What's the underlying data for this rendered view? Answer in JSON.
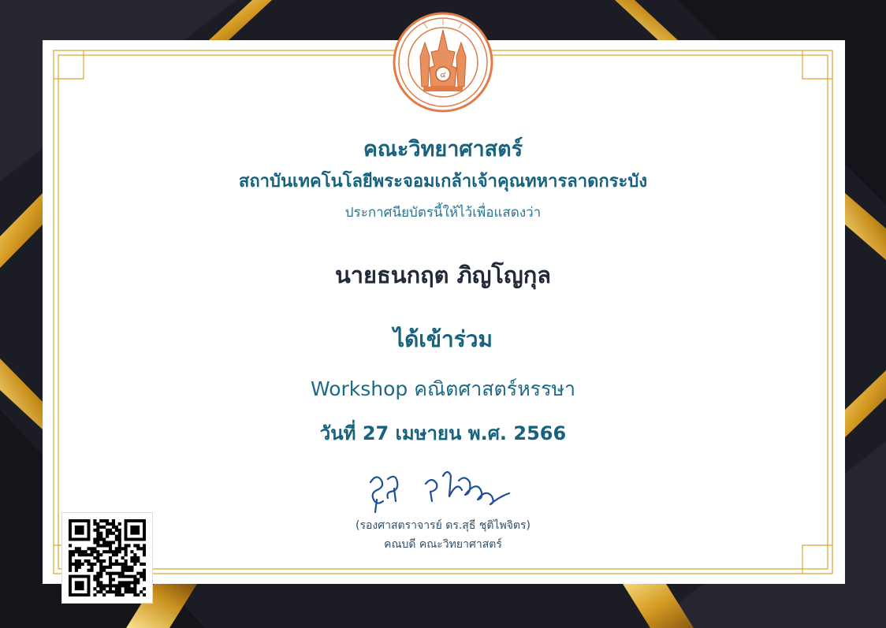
{
  "certificate": {
    "faculty": "คณะวิทยาศาสตร์",
    "institute": "สถาบันเทคโนโลยีพระจอมเกล้าเจ้าคุณทหารลาดกระบัง",
    "declaration": "ประกาศนียบัตรนี้ให้ไว้เพื่อแสดงว่า",
    "recipient": "นายธนกฤต ภิญโญกุล",
    "attended": "ได้เข้าร่วม",
    "event": "Workshop คณิตศาสตร์หรรษา",
    "date": "วันที่ 27 เมษายน พ.ศ. 2566",
    "signer_name": "(รองศาสตราจารย์ ดร.สุธี  ชุติไพจิตร)",
    "signer_title": "คณบดี คณะวิทยาศาสตร์",
    "seal_text": "สถาบันเทคโนโลยีพระจอมเกล้าเจ้าคุณทหารลาดกระบัง"
  },
  "colors": {
    "primary_text": "#17637f",
    "name_text": "#222a3a",
    "gold": "#d9a52b",
    "seal": "#e07b45",
    "dark_background": "#1c1c24"
  }
}
